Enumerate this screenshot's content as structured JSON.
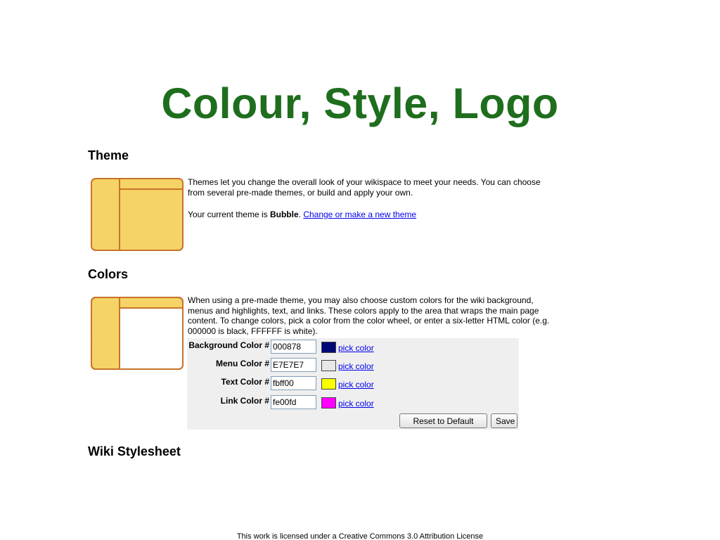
{
  "slide": {
    "title": "Colour, Style, Logo"
  },
  "theme": {
    "heading": "Theme",
    "description": "Themes let you change the overall look of your wikispace to meet your needs. You can choose from several pre-made themes, or build and apply your own.",
    "current_prefix": "Your current theme is ",
    "current_name": "Bubble",
    "current_suffix": ".",
    "change_link": "Change or make a new theme"
  },
  "colors": {
    "heading": "Colors",
    "description": "When using a pre-made theme, you may also choose custom colors for the wiki background, menus and highlights, text, and links. These colors apply to the area that wraps the main page content. To change colors, pick a color from the color wheel, or enter a six-letter HTML color (e.g. 000000 is black, FFFFFF is white).",
    "rows": [
      {
        "label": "Background Color #",
        "value": "000878",
        "swatch": "#000878",
        "pick_label": "pick color"
      },
      {
        "label": "Menu Color #",
        "value": "E7E7E7",
        "swatch": "#E7E7E7",
        "pick_label": "pick color"
      },
      {
        "label": "Text Color #",
        "value": "fbff00",
        "swatch": "#fbff00",
        "pick_label": "pick color"
      },
      {
        "label": "Link Color #",
        "value": "fe00fd",
        "swatch": "#fe00fd",
        "pick_label": "pick color"
      }
    ],
    "reset_label": "Reset to Default",
    "save_label": "Save"
  },
  "stylesheet": {
    "heading": "Wiki Stylesheet"
  },
  "footer": {
    "license": "This work is licensed under a Creative Commons 3.0 Attribution License"
  },
  "palette": {
    "title_green": "#1e6e1e",
    "thumb_fill": "#f5d366",
    "thumb_border": "#c8732a",
    "link_blue": "#0000ee"
  }
}
